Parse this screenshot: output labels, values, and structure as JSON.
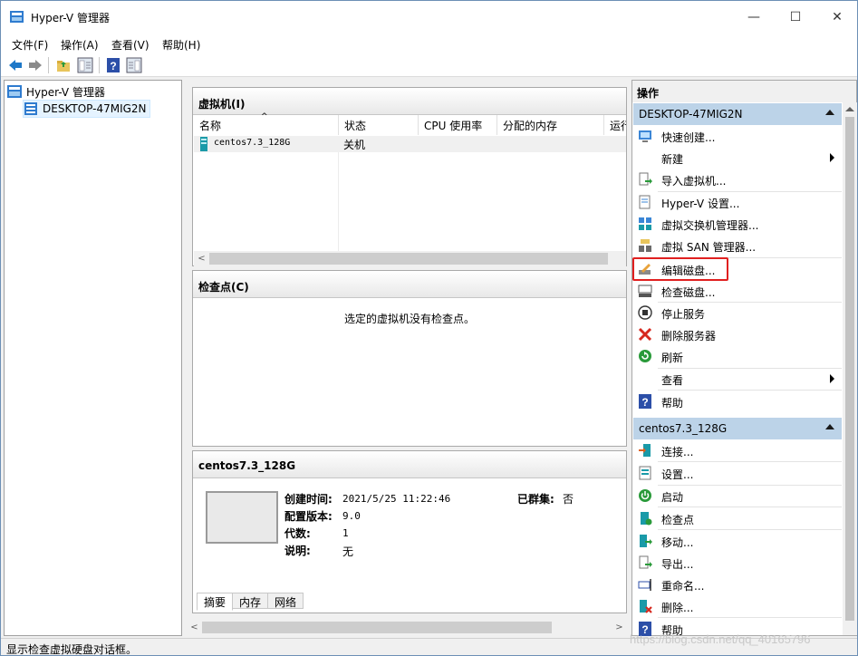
{
  "window": {
    "title": "Hyper-V 管理器"
  },
  "menu": [
    "文件(F)",
    "操作(A)",
    "查看(V)",
    "帮助(H)"
  ],
  "tree": {
    "root": "Hyper-V 管理器",
    "host": "DESKTOP-47MIG2N"
  },
  "vm_panel": {
    "title": "虚拟机(I)",
    "columns": [
      "名称",
      "状态",
      "CPU 使用率",
      "分配的内存",
      "运行"
    ],
    "rows": [
      {
        "name": "centos7.3_128G",
        "state": "关机"
      }
    ]
  },
  "checkpoint_panel": {
    "title": "检查点(C)",
    "empty_text": "选定的虚拟机没有检查点。"
  },
  "details": {
    "title": "centos7.3_128G",
    "created_label": "创建时间:",
    "created_value": "2021/5/25 11:22:46",
    "config_label": "配置版本:",
    "config_value": "9.0",
    "gen_label": "代数:",
    "gen_value": "1",
    "notes_label": "说明:",
    "notes_value": "无",
    "clustered_label": "已群集:",
    "clustered_value": "否",
    "tabs": [
      "摘要",
      "内存",
      "网络"
    ]
  },
  "actions": {
    "title": "操作",
    "host_section": "DESKTOP-47MIG2N",
    "host_items": [
      "快速创建...",
      "新建",
      "导入虚拟机...",
      "Hyper-V 设置...",
      "虚拟交换机管理器...",
      "虚拟 SAN 管理器...",
      "编辑磁盘...",
      "检查磁盘...",
      "停止服务",
      "删除服务器",
      "刷新",
      "查看",
      "帮助"
    ],
    "vm_section": "centos7.3_128G",
    "vm_items": [
      "连接...",
      "设置...",
      "启动",
      "检查点",
      "移动...",
      "导出...",
      "重命名...",
      "删除...",
      "帮助"
    ]
  },
  "status_text": "显示检查虚拟硬盘对话框。",
  "watermark": "https://blog.csdn.net/qq_40165796",
  "colors": {
    "section_bg": "#bcd3e8",
    "highlight_border": "#e02020",
    "selection_bg": "#e5f3ff"
  }
}
